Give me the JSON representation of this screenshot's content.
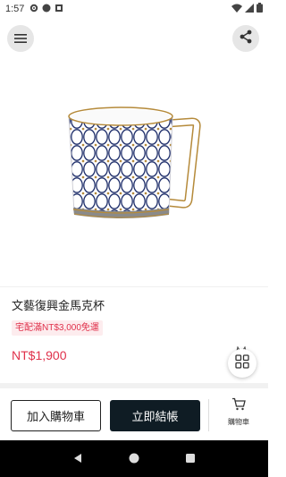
{
  "status_bar": {
    "time": "1:57",
    "icons": [
      "gear-icon",
      "circle-icon",
      "a-badge-icon",
      "wifi-icon",
      "signal-icon",
      "battery-icon"
    ]
  },
  "header": {
    "menu_icon": "hamburger-icon",
    "share_icon": "share-icon"
  },
  "product": {
    "image_alt": "mug",
    "title": "文藝復興金馬克杯",
    "promo_badge": "宅配滿NT$3,000免運",
    "price": "NT$1,900"
  },
  "actions": {
    "add_to_cart": "加入購物車",
    "checkout": "立即結帳",
    "cart_label": "購物車"
  },
  "colors": {
    "accent_red": "#e0314b",
    "badge_bg": "#fdecee",
    "checkout_bg": "#0f1c24",
    "mug_blue": "#1f2f6b",
    "mug_gold": "#b58a3a"
  },
  "nav_bar": {
    "buttons": [
      "back-icon",
      "home-icon",
      "recents-icon"
    ]
  }
}
